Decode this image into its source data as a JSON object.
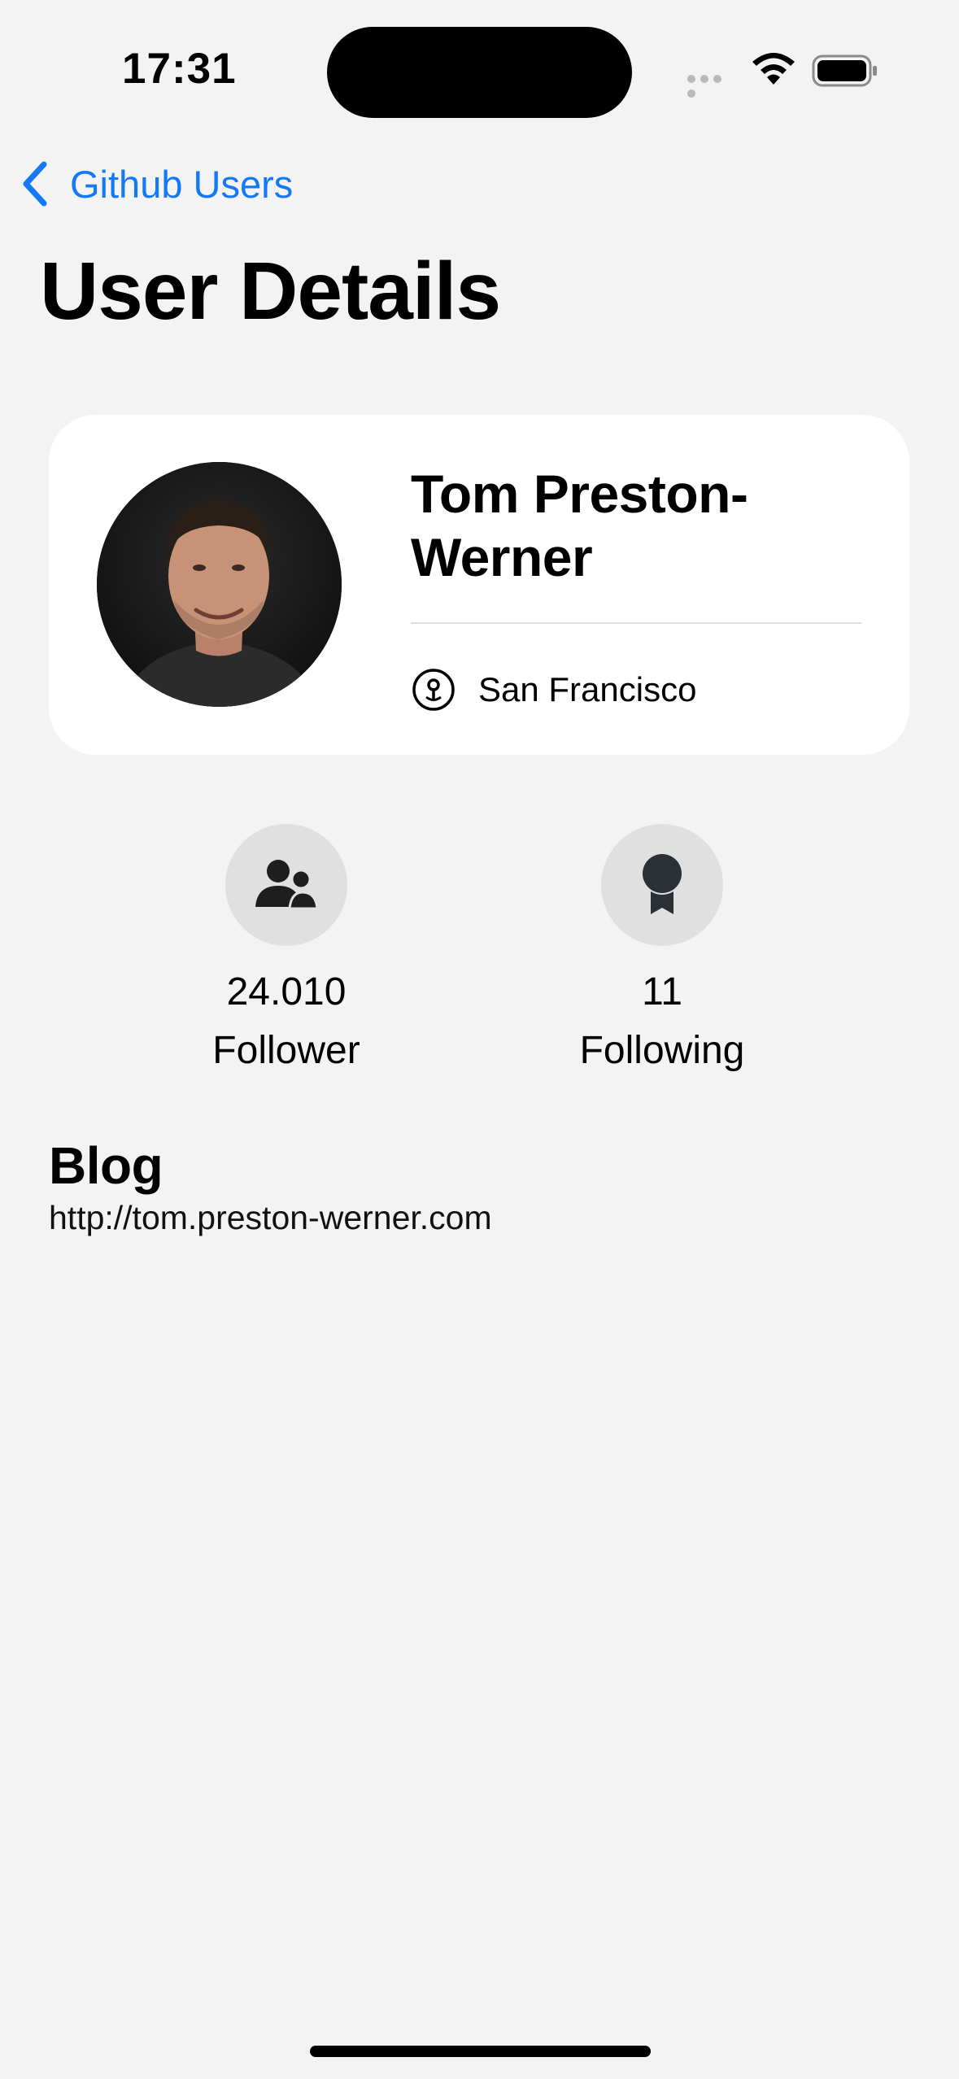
{
  "status_bar": {
    "time": "17:31",
    "icons": [
      "signal-icon",
      "wifi-icon",
      "battery-icon"
    ]
  },
  "nav": {
    "back_label": "Github Users",
    "title": "User Details"
  },
  "profile": {
    "name": "Tom Preston-Werner",
    "location": "San Francisco",
    "avatar_icon": "avatar-photo",
    "location_icon": "location-pin-icon"
  },
  "stats": {
    "followers": {
      "count": "24.010",
      "label": "Follower",
      "icon": "people-icon"
    },
    "following": {
      "count": "11",
      "label": "Following",
      "icon": "award-badge-icon"
    }
  },
  "blog": {
    "heading": "Blog",
    "url": "http://tom.preston-werner.com"
  },
  "colors": {
    "accent": "#1479f6",
    "background": "#f3f3f3",
    "card": "#ffffff",
    "stat_circle": "#e0e0e0"
  }
}
